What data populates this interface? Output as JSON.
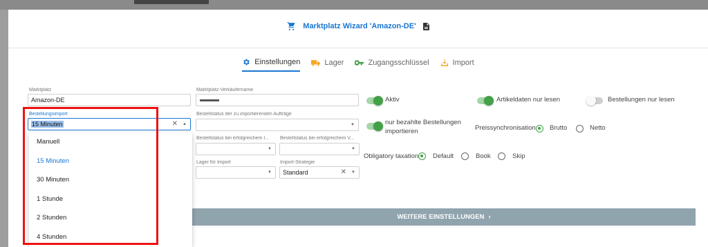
{
  "header": {
    "title": "Marktplatz Wizard 'Amazon-DE'",
    "cart_icon": "cart-icon",
    "doc_icon": "document-icon"
  },
  "tabs": [
    {
      "label": "Einstellungen",
      "icon": "gear-icon",
      "color": "#1976d2",
      "active": true
    },
    {
      "label": "Lager",
      "icon": "truck-icon",
      "color": "#f9a825"
    },
    {
      "label": "Zugangsschlüssel",
      "icon": "key-icon",
      "color": "#43a047"
    },
    {
      "label": "Import",
      "icon": "import-icon",
      "color": "#f9a825"
    }
  ],
  "form": {
    "marktplatz": {
      "label": "Marktplatz",
      "value": "Amazon-DE"
    },
    "verkaeufername": {
      "label": "Marktplatz-Verkäufername",
      "value": ""
    },
    "bestellungsimport": {
      "label": "Bestellungsimport",
      "value": "15 Minuten"
    },
    "bestellstatus_import": {
      "label": "Bestellstatus der zu importierenden Aufträge"
    },
    "bestellstatus_erfolg1": {
      "label": "Bestellstatus bei erfolgreichem I..."
    },
    "bestellstatus_erfolg2": {
      "label": "Bestellstatus bei erfolgreichem V..."
    },
    "lager_import": {
      "label": "Lager für Import"
    },
    "import_strategie": {
      "label": "Import-Strategie",
      "value": "Standard"
    }
  },
  "toggles": {
    "aktiv": {
      "label": "Aktiv",
      "on": true
    },
    "artikeldaten": {
      "label": "Artikeldaten nur lesen",
      "on": true
    },
    "bestellungen": {
      "label": "Bestellungen nur lesen",
      "on": false
    },
    "bezahlte": {
      "label_line1": "nur bezahlte Bestellungen",
      "label_line2": "importieren",
      "on": true
    }
  },
  "preissync": {
    "label": "Preissynchronisation",
    "options": [
      "Brutto",
      "Netto"
    ],
    "selected": "Brutto"
  },
  "taxation": {
    "label": "Obligatory taxation",
    "options": [
      "Default",
      "Book",
      "Skip"
    ],
    "selected": "Default"
  },
  "weitere_button": "WEITERE EINSTELLUNGEN",
  "dropdown": {
    "options": [
      "Manuell",
      "15 Minuten",
      "30 Minuten",
      "1 Stunde",
      "2 Stunden",
      "4 Stunden"
    ],
    "selected": "15 Minuten"
  },
  "colors": {
    "accent": "#1976d2",
    "toggle_on": "#43a047",
    "highlight": "#e11111",
    "button_bg": "#90a4ae"
  }
}
